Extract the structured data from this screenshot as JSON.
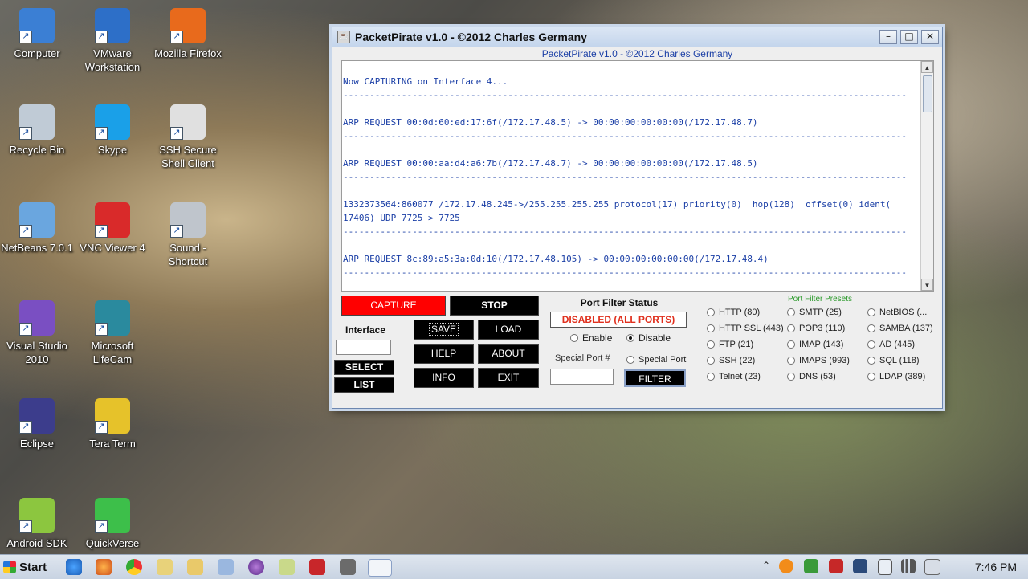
{
  "desktop": {
    "icons": [
      {
        "label": "Computer",
        "color": "#3b7fd4"
      },
      {
        "label": "VMware Workstation",
        "color": "#2d6fc8"
      },
      {
        "label": "Mozilla Firefox",
        "color": "#e86a1c"
      },
      {
        "label": "Recycle Bin",
        "color": "#c0cbd6"
      },
      {
        "label": "Skype",
        "color": "#1aa0e8"
      },
      {
        "label": "SSH Secure Shell Client",
        "color": "#e0e0e0"
      },
      {
        "label": "NetBeans 7.0.1",
        "color": "#6aa6df"
      },
      {
        "label": "VNC Viewer 4",
        "color": "#d92a2a"
      },
      {
        "label": "Sound - Shortcut",
        "color": "#bfc5cc"
      },
      {
        "label": "Visual Studio 2010",
        "color": "#7a4fc2"
      },
      {
        "label": "Microsoft LifeCam",
        "color": "#2a8a9e"
      },
      {
        "label": "Eclipse",
        "color": "#3c3d8c"
      },
      {
        "label": "Tera Term",
        "color": "#e6c22a"
      },
      {
        "label": "Android SDK",
        "color": "#8cc63f"
      },
      {
        "label": "QuickVerse",
        "color": "#3dbf4a"
      }
    ]
  },
  "window": {
    "title": "PacketPirate v1.0   -   ©2012 Charles Germany",
    "subtitle": "PacketPirate v1.0   -   ©2012 Charles Germany",
    "minimize": "–",
    "maximize": "□",
    "close": "✕"
  },
  "log": {
    "lines": [
      "Now CAPTURING on Interface 4...",
      "----------------------------------------------------------------------------------------------------------",
      "",
      "ARP REQUEST 00:0d:60:ed:17:6f(/172.17.48.5) -> 00:00:00:00:00:00(/172.17.48.7)",
      "----------------------------------------------------------------------------------------------------------",
      "",
      "ARP REQUEST 00:00:aa:d4:a6:7b(/172.17.48.7) -> 00:00:00:00:00:00(/172.17.48.5)",
      "----------------------------------------------------------------------------------------------------------",
      "",
      "1332373564:860077 /172.17.48.245->/255.255.255.255 protocol(17) priority(0)  hop(128)  offset(0) ident(",
      "17406) UDP 7725 > 7725",
      "----------------------------------------------------------------------------------------------------------",
      "",
      "ARP REQUEST 8c:89:a5:3a:0d:10(/172.17.48.105) -> 00:00:00:00:00:00(/172.17.48.4)",
      "----------------------------------------------------------------------------------------------------------"
    ],
    "scroll_up": "▲",
    "scroll_down": "▼"
  },
  "controls": {
    "capture": "CAPTURE",
    "stop": "STOP",
    "interface_label": "Interface",
    "interface_value": "",
    "select": "SELECT",
    "list": "LIST",
    "save": "SAVE",
    "load": "LOAD",
    "help": "HELP",
    "about": "ABOUT",
    "info": "INFO",
    "exit": "EXIT",
    "capture_color": "#ff0000"
  },
  "port_filter": {
    "status_title": "Port Filter Status",
    "status_value": "DISABLED (ALL PORTS)",
    "status_color": "#e0301e",
    "enable": "Enable",
    "disable": "Disable",
    "enabled": false,
    "special_port_label": "Special Port #",
    "special_port_value": "",
    "special_port_radio": "Special Port",
    "filter": "FILTER"
  },
  "presets": {
    "title": "Port Filter Presets",
    "title_color": "#2a9a2a",
    "columns": [
      [
        "HTTP (80)",
        "HTTP SSL (443)",
        "FTP (21)",
        "SSH (22)",
        "Telnet (23)"
      ],
      [
        "SMTP (25)",
        "POP3 (110)",
        "IMAP (143)",
        "IMAPS (993)",
        "DNS (53)"
      ],
      [
        "NetBIOS (...",
        "SAMBA (137)",
        "AD (445)",
        "SQL (118)",
        "LDAP (389)"
      ]
    ]
  },
  "taskbar": {
    "start": "Start",
    "clock": "7:46 PM",
    "show_hidden": "⌃"
  }
}
